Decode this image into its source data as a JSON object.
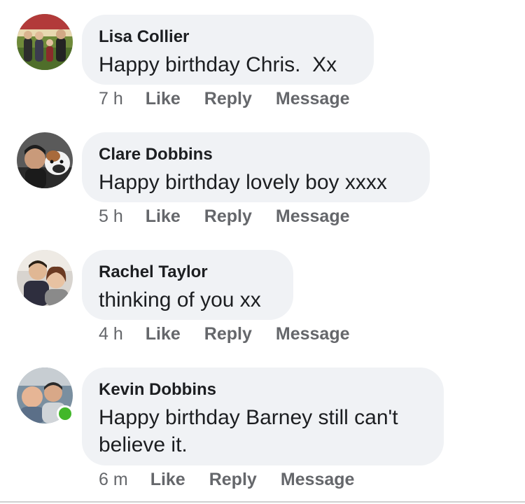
{
  "comments": [
    {
      "name": "Lisa Collier",
      "text": "Happy birthday Chris.  Xx",
      "time": "7 h",
      "like": "Like",
      "reply": "Reply",
      "message": "Message",
      "online": false
    },
    {
      "name": "Clare Dobbins",
      "text": "Happy birthday lovely boy xxxx",
      "time": "5 h",
      "like": "Like",
      "reply": "Reply",
      "message": "Message",
      "online": false
    },
    {
      "name": "Rachel Taylor",
      "text": "thinking of you xx",
      "time": "4 h",
      "like": "Like",
      "reply": "Reply",
      "message": "Message",
      "online": false
    },
    {
      "name": "Kevin Dobbins",
      "text": "Happy birthday Barney still can't\nbelieve it.",
      "time": "6 m",
      "like": "Like",
      "reply": "Reply",
      "message": "Message",
      "online": true
    }
  ],
  "colors": {
    "bubble": "#f0f2f5",
    "name_text": "#1c1e21",
    "meta_text": "#65676b",
    "online": "#42b72a"
  }
}
